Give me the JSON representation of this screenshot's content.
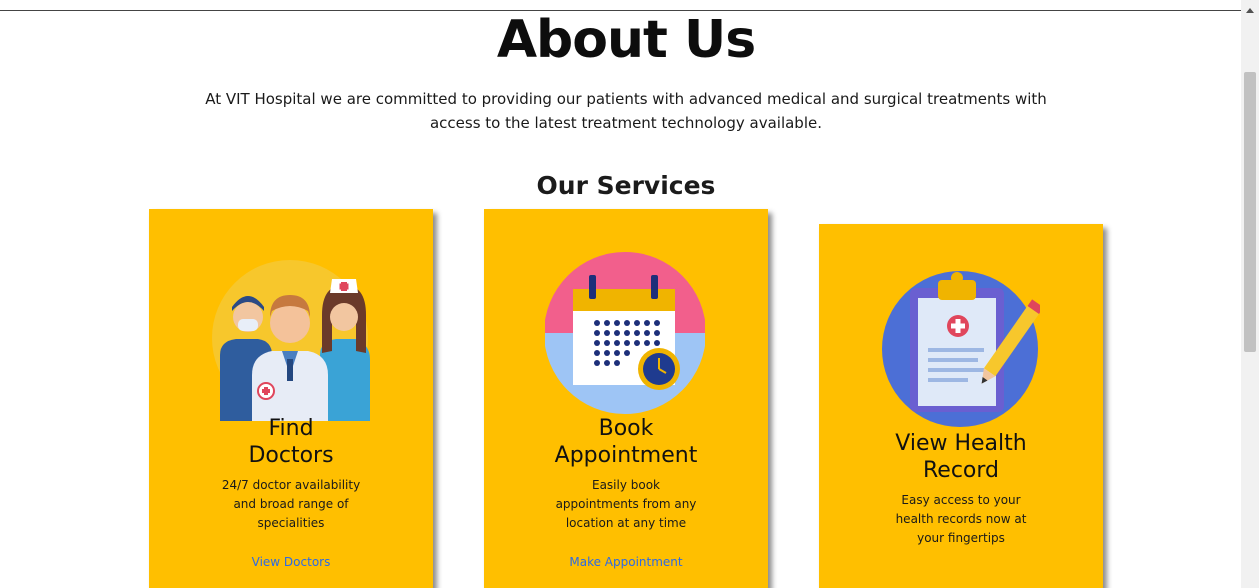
{
  "about": {
    "title": "About Us",
    "description": "At VIT Hospital we are committed to providing our patients with advanced medical and surgical treatments with access to the latest treatment technology available."
  },
  "services": {
    "title": "Our Services",
    "cards": [
      {
        "icon": "doctors-icon",
        "title_line1": "Find",
        "title_line2": "Doctors",
        "desc_line1": "24/7 doctor availability",
        "desc_line2": "and broad range of",
        "desc_line3": "specialities",
        "link": "View Doctors"
      },
      {
        "icon": "calendar-icon",
        "title_line1": "Book",
        "title_line2": "Appointment",
        "desc_line1": "Easily book",
        "desc_line2": "appointments from any",
        "desc_line3": "location at any time",
        "link": "Make Appointment"
      },
      {
        "icon": "health-record-icon",
        "title_line1": "View Health",
        "title_line2": "Record",
        "desc_line1": "Easy access to your",
        "desc_line2": "health records now at",
        "desc_line3": "your fingertips"
      }
    ]
  },
  "colors": {
    "card_background": "#ffbf00",
    "link": "#2d6be4"
  }
}
